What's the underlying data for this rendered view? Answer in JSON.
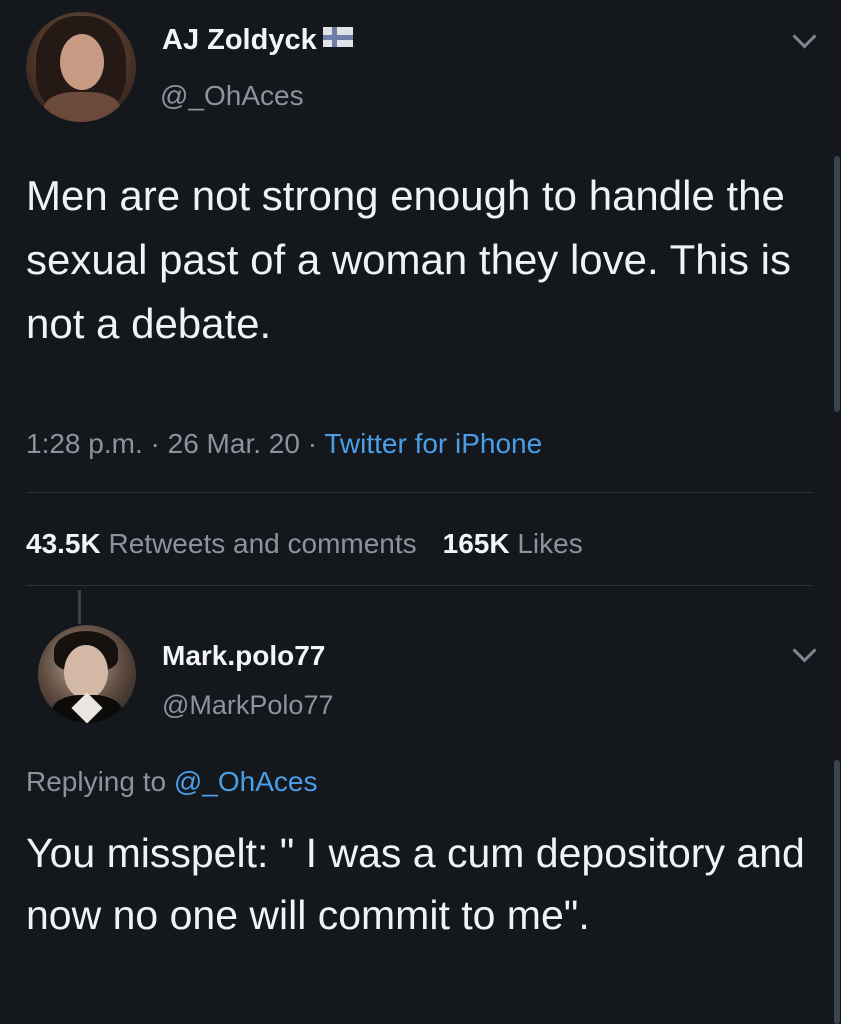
{
  "tweet": {
    "author_name": "AJ Zoldyck",
    "handle": "@_OhAces",
    "text": "Men are not strong enough to handle the sexual past of a woman they love. This is not a debate.",
    "time": "1:28 p.m.",
    "date": "26 Mar. 20",
    "source": "Twitter for iPhone",
    "separator": " · ",
    "retweets_count": "43.5K",
    "retweets_label": "Retweets and comments",
    "likes_count": "165K",
    "likes_label": "Likes",
    "flag_icon": "flag-icon",
    "menu_icon": "chevron-down-icon"
  },
  "reply": {
    "author_name": "Mark.polo77",
    "handle": "@MarkPolo77",
    "replying_prefix": "Replying to",
    "replying_to": "@_OhAces",
    "text": "You misspelt: \" I was a cum depository and now no one will commit to me\".",
    "menu_icon": "chevron-down-icon"
  },
  "colors": {
    "background": "#14171b",
    "text": "#f0f2f4",
    "muted": "#8a949e",
    "link": "#4a9ee8"
  }
}
